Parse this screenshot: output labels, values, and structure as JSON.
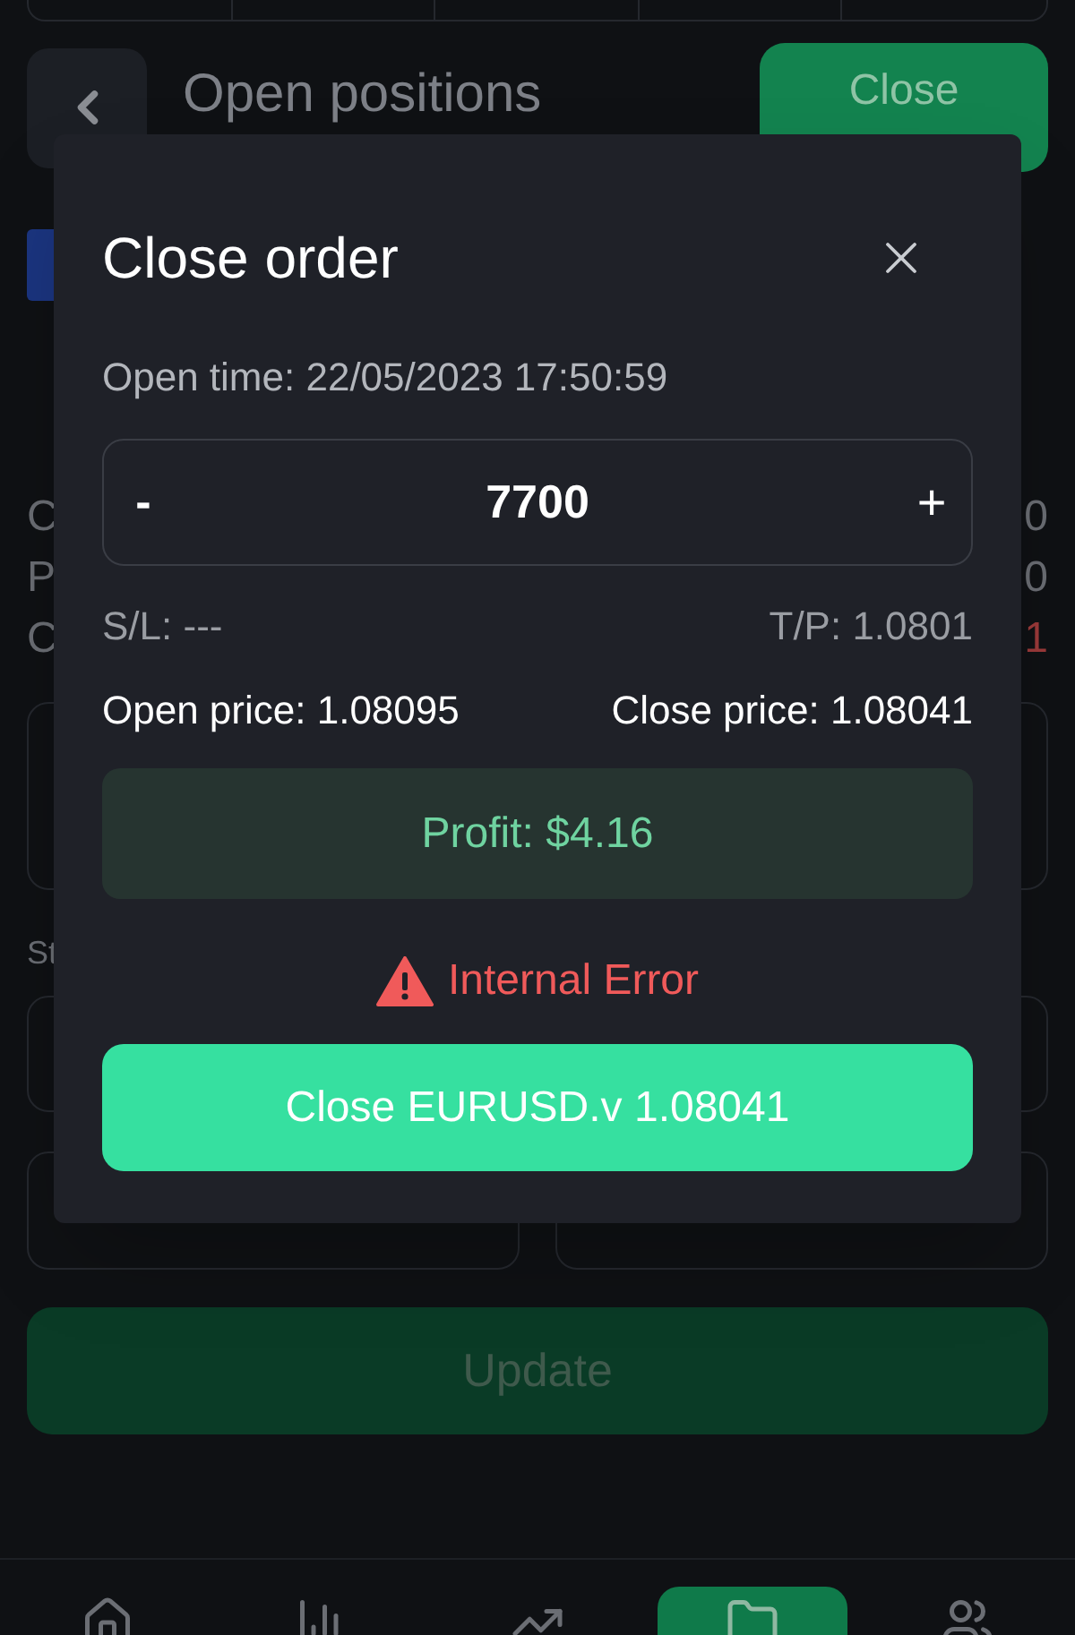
{
  "page": {
    "title": "Open positions",
    "close_button": "Close",
    "row_labels": [
      "C",
      "P",
      "C"
    ],
    "row_values": [
      {
        "text": "0",
        "kind": "neutral"
      },
      {
        "text": "0",
        "kind": "neutral"
      },
      {
        "text": "1",
        "kind": "negative"
      }
    ],
    "section_label": "St",
    "update_button": "Update"
  },
  "nav": [
    {
      "kind": "home",
      "selected": false
    },
    {
      "kind": "chart",
      "selected": false
    },
    {
      "kind": "trend",
      "selected": false
    },
    {
      "kind": "folder",
      "selected": true
    },
    {
      "kind": "people",
      "selected": false
    }
  ],
  "dialog": {
    "title": "Close order",
    "open_time": "Open time: 22/05/2023 17:50:59",
    "quantity": {
      "minus": "-",
      "value": "7700",
      "plus": "+"
    },
    "sl": "S/L: ---",
    "tp": "T/P: 1.0801",
    "open_price": "Open price: 1.08095",
    "close_price": "Close price: 1.08041",
    "profit": "Profit: $4.16",
    "error": "Internal Error",
    "confirm_button": "Close EURUSD.v 1.08041"
  }
}
